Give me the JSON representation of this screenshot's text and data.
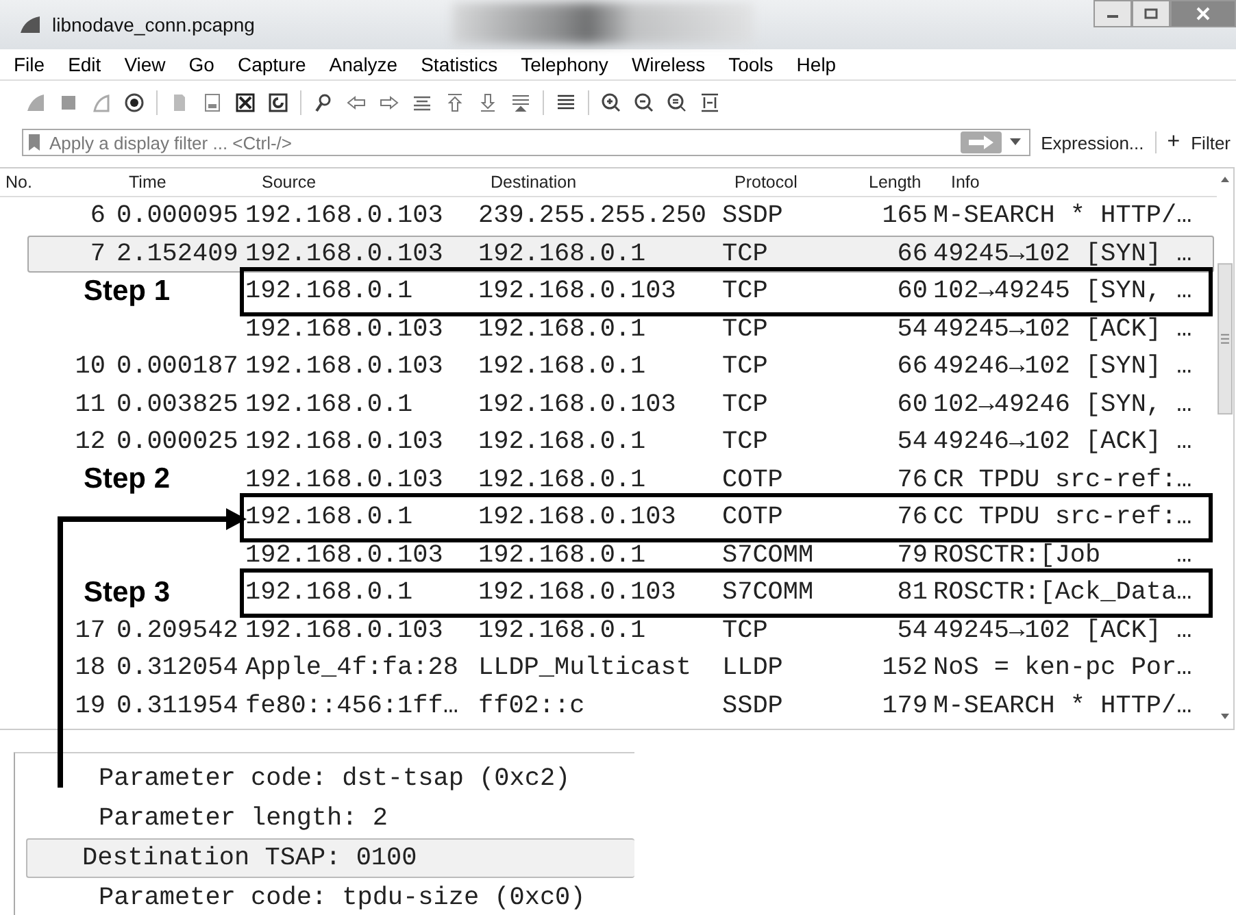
{
  "window": {
    "title": "libnodave_conn.pcapng"
  },
  "menu": [
    "File",
    "Edit",
    "View",
    "Go",
    "Capture",
    "Analyze",
    "Statistics",
    "Telephony",
    "Wireless",
    "Tools",
    "Help"
  ],
  "filter": {
    "placeholder": "Apply a display filter ... <Ctrl-/>",
    "expression_label": "Expression...",
    "add_label": "+",
    "filter_label": "Filter"
  },
  "columns": [
    "No.",
    "Time",
    "Source",
    "Destination",
    "Protocol",
    "Length",
    "Info"
  ],
  "rows": [
    {
      "no": "6",
      "time": "0.000095",
      "source": "192.168.0.103",
      "destination": "239.255.255.250",
      "protocol": "SSDP",
      "length": "165",
      "info": "M-SEARCH * HTTP/…",
      "selected": false,
      "boxed": false,
      "arrow": false
    },
    {
      "no": "7",
      "time": "2.152409",
      "source": "192.168.0.103",
      "destination": "192.168.0.1",
      "protocol": "TCP",
      "length": "66",
      "info": "49245→102 [SYN] …",
      "selected": true,
      "boxed": false,
      "arrow": false
    },
    {
      "step": "Step 1",
      "source": "192.168.0.1",
      "destination": "192.168.0.103",
      "protocol": "TCP",
      "length": "60",
      "info": "102→49245 [SYN, …",
      "selected": false,
      "boxed": true,
      "arrow": false
    },
    {
      "source": "192.168.0.103",
      "destination": "192.168.0.1",
      "protocol": "TCP",
      "length": "54",
      "info": "49245→102 [ACK] …",
      "selected": false,
      "boxed": false,
      "arrow": false
    },
    {
      "no": "10",
      "time": "0.000187",
      "source": "192.168.0.103",
      "destination": "192.168.0.1",
      "protocol": "TCP",
      "length": "66",
      "info": "49246→102 [SYN] …",
      "selected": false,
      "boxed": false,
      "arrow": false
    },
    {
      "no": "11",
      "time": "0.003825",
      "source": "192.168.0.1",
      "destination": "192.168.0.103",
      "protocol": "TCP",
      "length": "60",
      "info": "102→49246 [SYN, …",
      "selected": false,
      "boxed": false,
      "arrow": false
    },
    {
      "no": "12",
      "time": "0.000025",
      "source": "192.168.0.103",
      "destination": "192.168.0.1",
      "protocol": "TCP",
      "length": "54",
      "info": "49246→102 [ACK] …",
      "selected": false,
      "boxed": false,
      "arrow": false
    },
    {
      "step": "Step 2",
      "source": "192.168.0.103",
      "destination": "192.168.0.1",
      "protocol": "COTP",
      "length": "76",
      "info": "CR TPDU src-ref:…",
      "selected": false,
      "boxed": false,
      "arrow": false
    },
    {
      "source": "192.168.0.1",
      "destination": "192.168.0.103",
      "protocol": "COTP",
      "length": "76",
      "info": "CC TPDU src-ref:…",
      "selected": false,
      "boxed": true,
      "arrow": true
    },
    {
      "source": "192.168.0.103",
      "destination": "192.168.0.1",
      "protocol": "S7COMM",
      "length": "79",
      "info": "ROSCTR:[Job     …",
      "selected": false,
      "boxed": false,
      "arrow": false
    },
    {
      "step": "Step 3",
      "source": "192.168.0.1",
      "destination": "192.168.0.103",
      "protocol": "S7COMM",
      "length": "81",
      "info": "ROSCTR:[Ack_Data…",
      "selected": false,
      "boxed": true,
      "arrow": false
    },
    {
      "no": "17",
      "time": "0.209542",
      "source": "192.168.0.103",
      "destination": "192.168.0.1",
      "protocol": "TCP",
      "length": "54",
      "info": "49245→102 [ACK] …",
      "selected": false,
      "boxed": false,
      "arrow": false
    },
    {
      "no": "18",
      "time": "0.312054",
      "source": "Apple_4f:fa:28",
      "destination": "LLDP_Multicast",
      "protocol": "LLDP",
      "length": "152",
      "info": "NoS = ken-pc Por…",
      "selected": false,
      "boxed": false,
      "arrow": false
    },
    {
      "no": "19",
      "time": "0.311954",
      "source": "fe80::456:1ff…",
      "destination": "ff02::c",
      "protocol": "SSDP",
      "length": "179",
      "info": "M-SEARCH * HTTP/…",
      "selected": false,
      "boxed": false,
      "arrow": false
    }
  ],
  "details": [
    {
      "text": "Parameter code: dst-tsap (0xc2)",
      "selected": false
    },
    {
      "text": "Parameter length: 2",
      "selected": false
    },
    {
      "text": "Destination TSAP: 0100",
      "selected": true
    },
    {
      "text": "Parameter code: tpdu-size (0xc0)",
      "selected": false
    }
  ]
}
